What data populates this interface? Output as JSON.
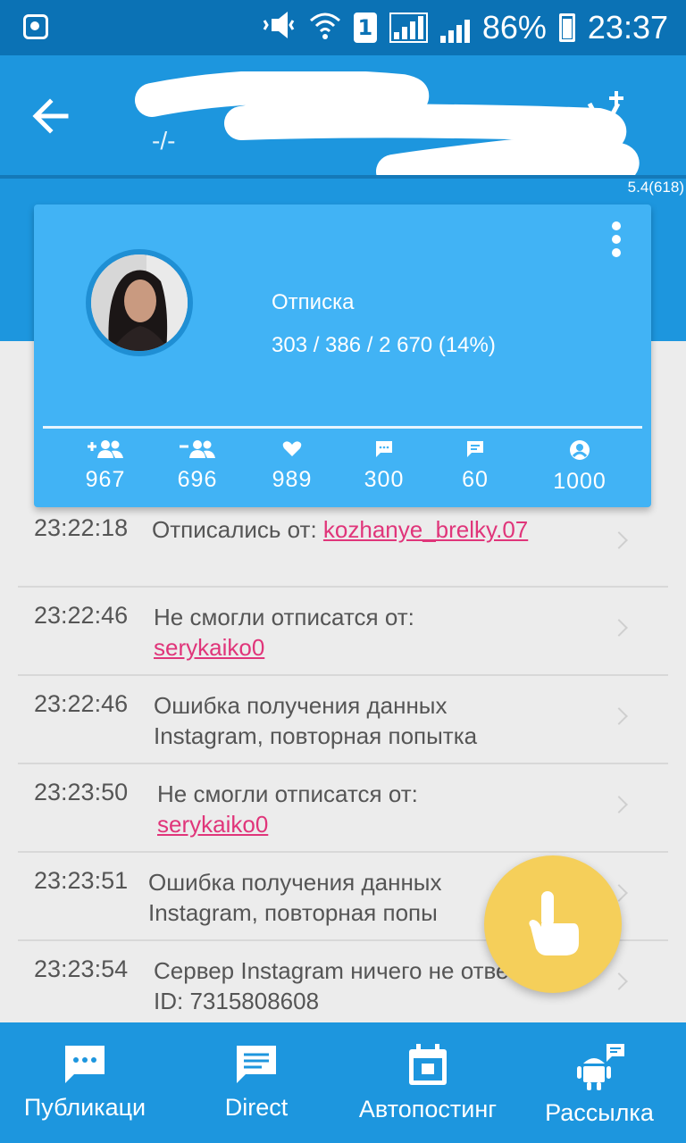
{
  "status_bar": {
    "battery_text": "86%",
    "time": "23:37",
    "sim_slot": "1",
    "icons": [
      "instagram-icon",
      "mute-vibrate-icon",
      "wifi-icon",
      "sim-icon",
      "signal-icon",
      "signal-icon",
      "battery-icon"
    ]
  },
  "app_bar": {
    "subtitle": "-/-",
    "version": "5.4(618)",
    "background": "#1d96de"
  },
  "card": {
    "task_label": "Отписка",
    "task_stats": "303 / 386 / 2 670 (14%)",
    "counters": [
      {
        "icon": "follow-add-icon",
        "value": "967"
      },
      {
        "icon": "unfollow-remove-icon",
        "value": "696"
      },
      {
        "icon": "heart-icon",
        "value": "989"
      },
      {
        "icon": "comment-icon",
        "value": "300"
      },
      {
        "icon": "direct-message-icon",
        "value": "60"
      },
      {
        "icon": "account-icon",
        "value": "1000"
      }
    ]
  },
  "log": [
    {
      "time": "23:22:18",
      "text": "Отписались от:",
      "link": "kozhanye_brelky.07"
    },
    {
      "time": "23:22:46",
      "text": "Не смогли отписатся от:",
      "link": "serykaiko0"
    },
    {
      "time": "23:22:46",
      "text": "Ошибка получения данных Instagram, повторная попытка",
      "link": ""
    },
    {
      "time": "23:23:50",
      "text": "Не смогли отписатся от:",
      "link": "serykaiko0"
    },
    {
      "time": "23:23:51",
      "text": "Ошибка получения данных Instagram, повторная попы",
      "link": ""
    },
    {
      "time": "23:23:54",
      "text": "Сервер Instagram ничего не ответил ID: 7315808608",
      "link": ""
    }
  ],
  "bottom_nav": [
    {
      "label": "Публикаци",
      "icon": "publications-chat-icon"
    },
    {
      "label": "Direct",
      "icon": "direct-message-icon"
    },
    {
      "label": "Автопостинг",
      "icon": "calendar-icon"
    },
    {
      "label": "Рассылка",
      "icon": "android-message-icon"
    }
  ],
  "colors": {
    "accent": "#1d96de",
    "card": "#41b3f5",
    "link": "#e0357a",
    "fab": "#f5cf5a"
  }
}
